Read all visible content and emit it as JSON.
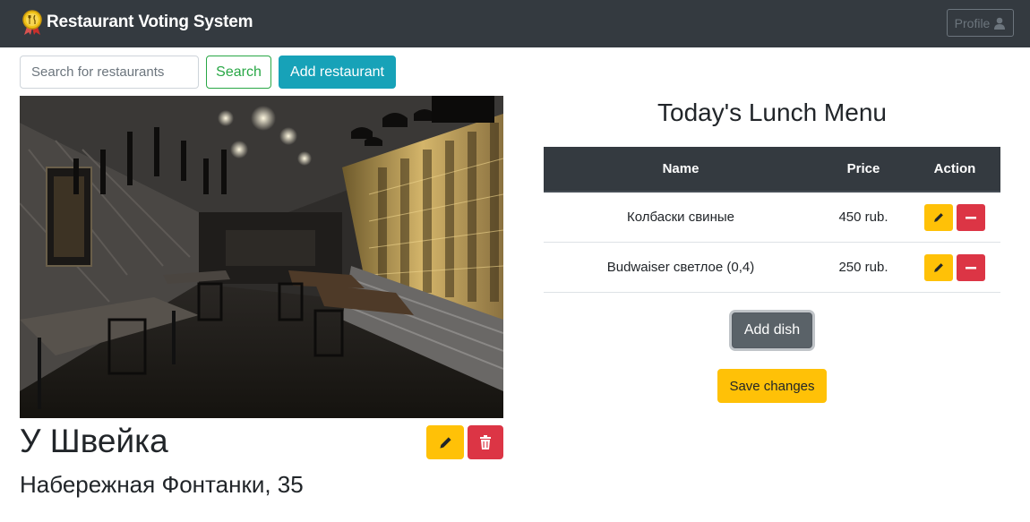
{
  "navbar": {
    "brand": "Restaurant Voting System",
    "profile_label": "Profile",
    "logo_icon": "medal-fork-knife-icon"
  },
  "toolbar": {
    "search_placeholder": "Search for restaurants",
    "search_label": "Search",
    "add_restaurant_label": "Add restaurant"
  },
  "restaurant": {
    "name": "У Швейка",
    "address": "Набережная Фонтанки, 35",
    "photo": "restaurant-interior-photo"
  },
  "menu": {
    "title": "Today's Lunch Menu",
    "columns": [
      "Name",
      "Price",
      "Action"
    ],
    "rows": [
      {
        "name": "Колбаски свиные",
        "price": "450 rub."
      },
      {
        "name": "Budwaiser светлое (0,4)",
        "price": "250 rub."
      }
    ],
    "add_dish_label": "Add dish",
    "save_label": "Save changes"
  },
  "colors": {
    "navbar": "#343a40",
    "success": "#28a745",
    "info": "#17a2b8",
    "warning": "#ffc107",
    "danger": "#dc3545",
    "secondary": "#5a6268"
  }
}
